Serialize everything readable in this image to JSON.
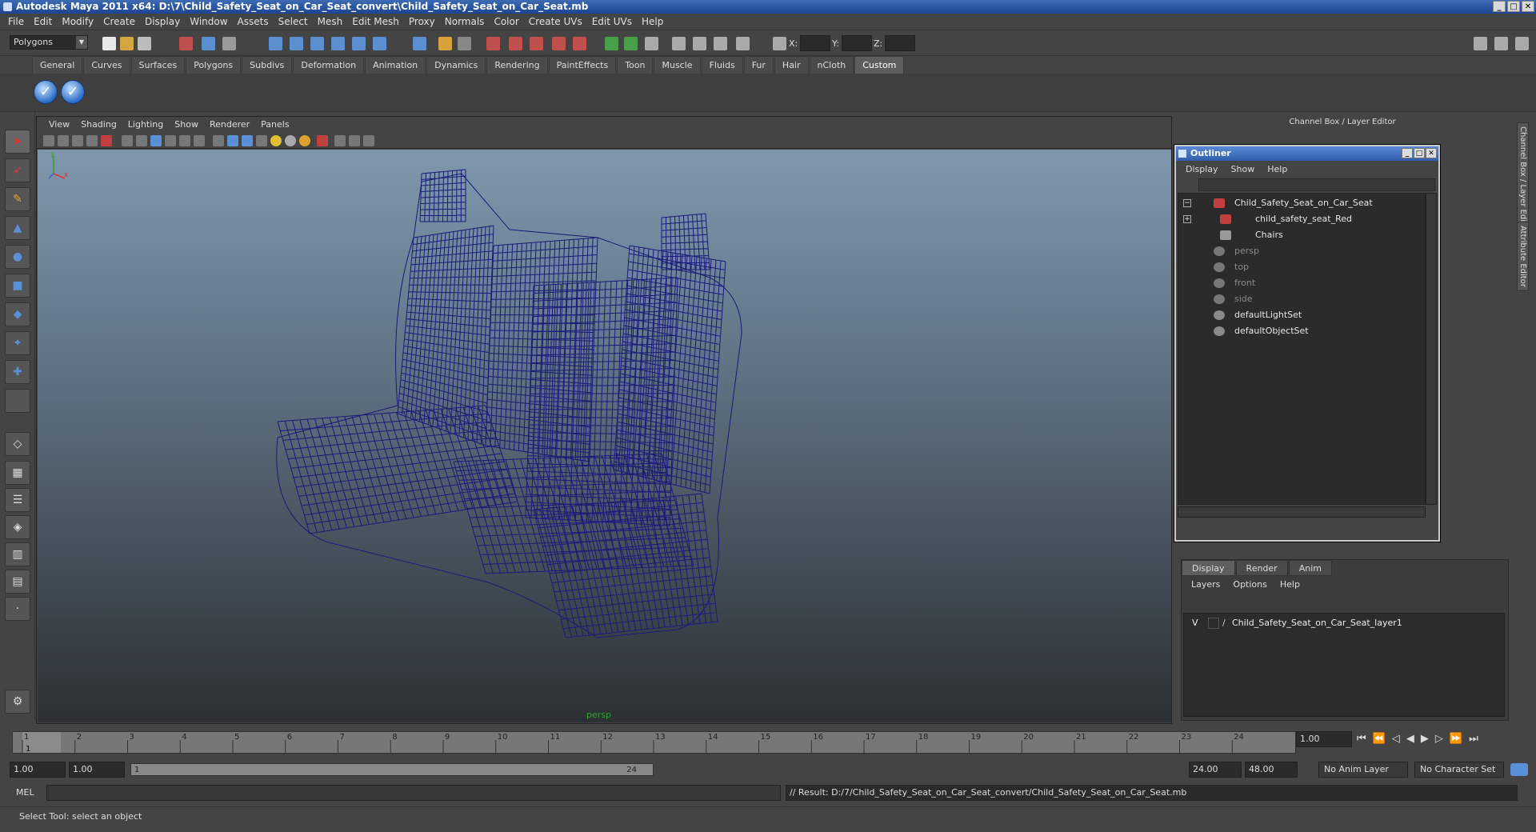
{
  "window": {
    "title": "Autodesk Maya 2011 x64: D:\\7\\Child_Safety_Seat_on_Car_Seat_convert\\Child_Safety_Seat_on_Car_Seat.mb",
    "minimize": "_",
    "maximize": "□",
    "close": "✕"
  },
  "menubar": [
    "File",
    "Edit",
    "Modify",
    "Create",
    "Display",
    "Window",
    "Assets",
    "Select",
    "Mesh",
    "Edit Mesh",
    "Proxy",
    "Normals",
    "Color",
    "Create UVs",
    "Edit UVs",
    "Help"
  ],
  "status": {
    "mode": "Polygons",
    "x_label": "X:",
    "y_label": "Y:",
    "z_label": "Z:"
  },
  "shelf_tabs": [
    "General",
    "Curves",
    "Surfaces",
    "Polygons",
    "Subdivs",
    "Deformation",
    "Animation",
    "Dynamics",
    "Rendering",
    "PaintEffects",
    "Toon",
    "Muscle",
    "Fluids",
    "Fur",
    "Hair",
    "nCloth",
    "Custom"
  ],
  "shelf_active": "Custom",
  "viewport": {
    "menu": [
      "View",
      "Shading",
      "Lighting",
      "Show",
      "Renderer",
      "Panels"
    ],
    "camera": "persp",
    "axis_x": "x",
    "axis_y": "y",
    "wire_color": "#1a1a7a",
    "bg_top": "#7f97ad",
    "bg_bottom": "#2c3033"
  },
  "channel_box_title": "Channel Box / Layer Editor",
  "outliner": {
    "title": "Outliner",
    "menu": [
      "Display",
      "Show",
      "Help"
    ],
    "items": [
      {
        "label": "Child_Safety_Seat_on_Car_Seat",
        "expander": "−",
        "icon": "mesh-icon",
        "dim": false
      },
      {
        "label": "child_safety_seat_Red",
        "expander": "+",
        "icon": "mesh-icon",
        "dim": false
      },
      {
        "label": "Chairs",
        "expander": "",
        "icon": "group-icon",
        "dim": false
      },
      {
        "label": "persp",
        "expander": "",
        "icon": "camera-icon",
        "dim": true
      },
      {
        "label": "top",
        "expander": "",
        "icon": "camera-icon",
        "dim": true
      },
      {
        "label": "front",
        "expander": "",
        "icon": "camera-icon",
        "dim": true
      },
      {
        "label": "side",
        "expander": "",
        "icon": "camera-icon",
        "dim": true
      },
      {
        "label": "defaultLightSet",
        "expander": "",
        "icon": "set-icon",
        "dim": false
      },
      {
        "label": "defaultObjectSet",
        "expander": "",
        "icon": "set-icon",
        "dim": false
      }
    ]
  },
  "layer_editor": {
    "tabs": [
      "Display",
      "Render",
      "Anim"
    ],
    "active_tab": "Display",
    "menu": [
      "Layers",
      "Options",
      "Help"
    ],
    "layer": {
      "visible": "V",
      "name": "Child_Safety_Seat_on_Car_Seat_layer1"
    }
  },
  "side_tabs": [
    "Channel Box / Layer Editor",
    "Attribute Editor"
  ],
  "timeline": {
    "ticks": [
      "1",
      "2",
      "3",
      "4",
      "5",
      "6",
      "7",
      "8",
      "9",
      "10",
      "11",
      "12",
      "13",
      "14",
      "15",
      "16",
      "17",
      "18",
      "19",
      "20",
      "21",
      "22",
      "23",
      "24"
    ],
    "current_frame": "1.00",
    "current_marker": "1"
  },
  "range": {
    "start": "1.00",
    "playback_start": "1.00",
    "slider_start": "1",
    "slider_end": "24",
    "playback_end": "24.00",
    "end": "48.00",
    "anim_layer": "No Anim Layer",
    "character_set": "No Character Set"
  },
  "command": {
    "label": "MEL",
    "result": "// Result: D:/7/Child_Safety_Seat_on_Car_Seat_convert/Child_Safety_Seat_on_Car_Seat.mb"
  },
  "help_line": "Select Tool: select an object"
}
